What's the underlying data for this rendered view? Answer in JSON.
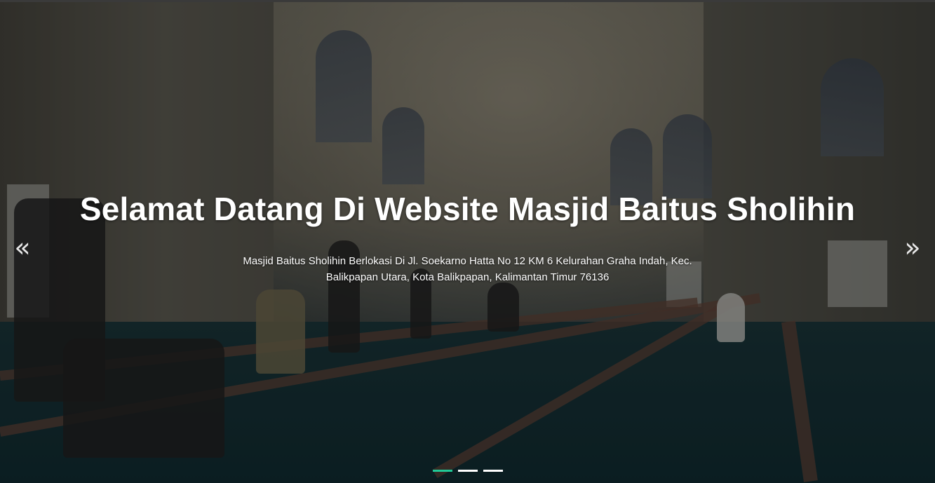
{
  "slide": {
    "title": "Selamat Datang Di Website Masjid Baitus Sholihin",
    "description_line1": "Masjid Baitus Sholihin Berlokasi Di Jl. Soekarno Hatta No 12 KM 6 Kelurahan Graha Indah, Kec.",
    "description_line2": "Balikpapan Utara, Kota Balikpapan, Kalimantan Timur 76136"
  },
  "controls": {
    "prev_icon": "double-chevron-left-icon",
    "next_icon": "double-chevron-right-icon",
    "prev_glyph": "«",
    "next_glyph": "»"
  },
  "indicators": {
    "count": 3,
    "active_index": 0,
    "active_color": "#20c997",
    "inactive_color": "#ffffff"
  }
}
